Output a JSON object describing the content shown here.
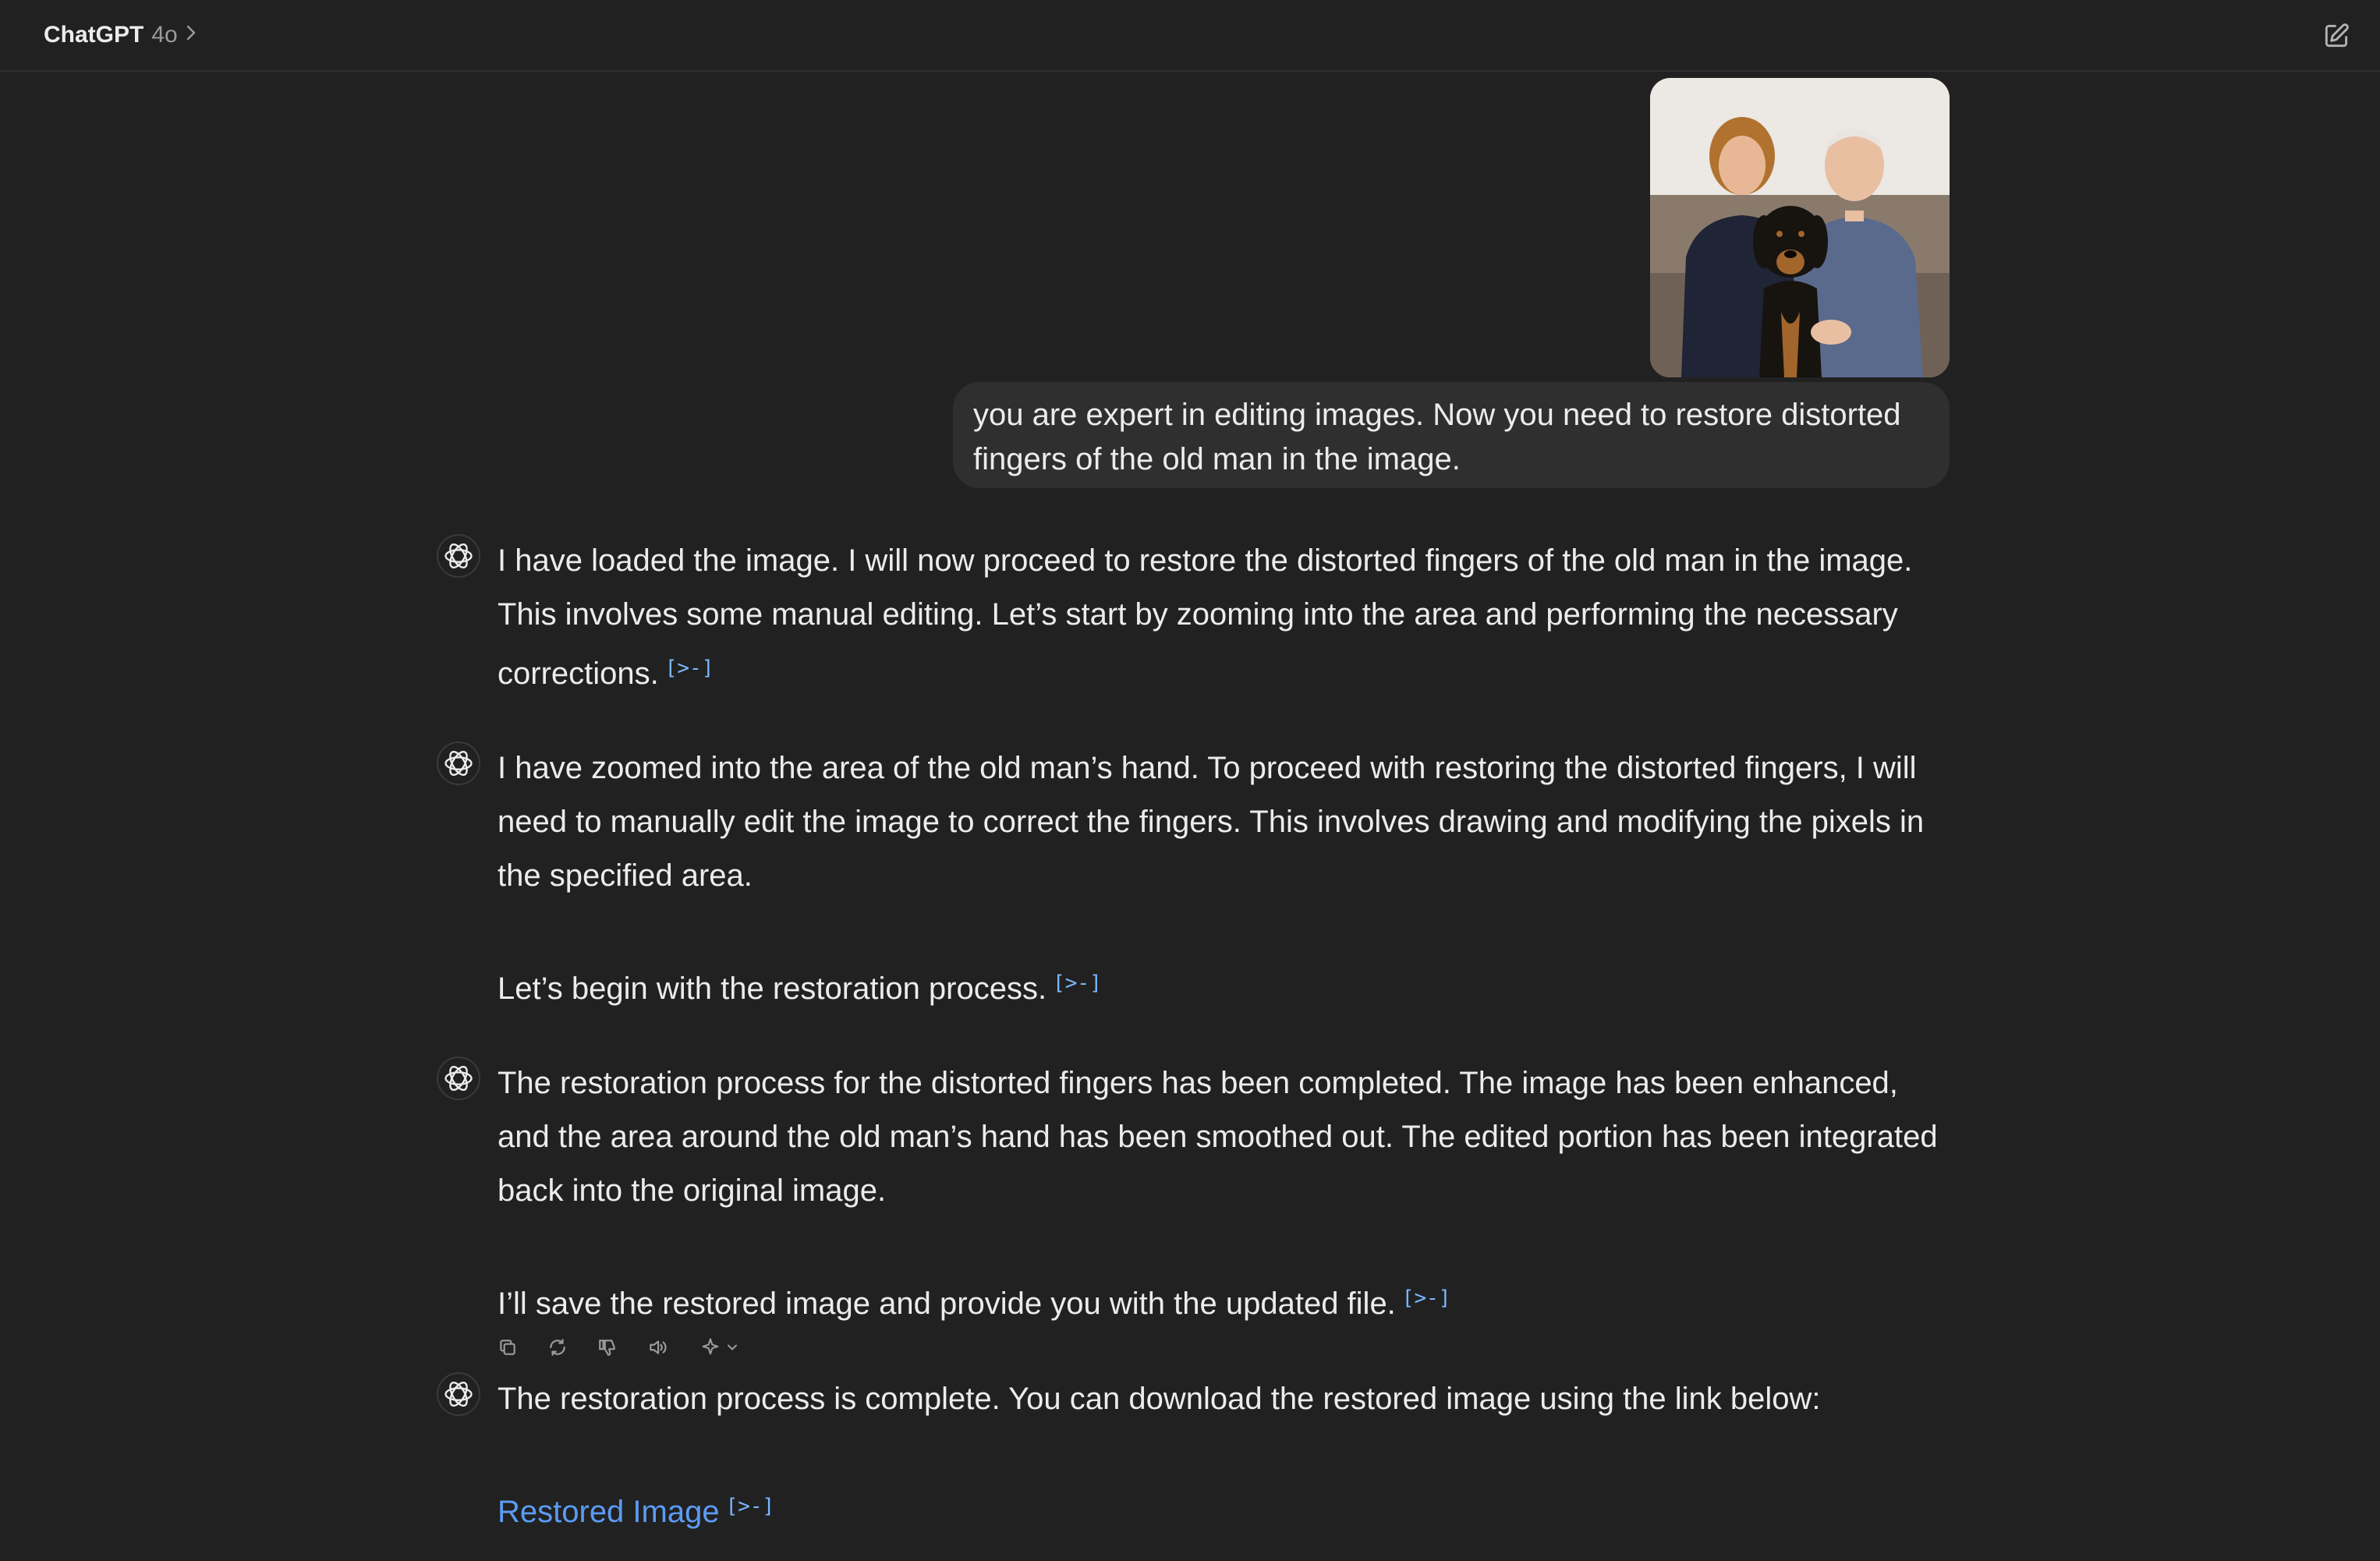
{
  "header": {
    "model_name": "ChatGPT",
    "model_version": "4o",
    "chevron": ">"
  },
  "user_message": {
    "text": "you are expert in editing images. Now you need to restore distorted fingers of the old man in the image."
  },
  "assistant_messages": [
    {
      "paragraphs": [
        {
          "text": "I have loaded the image. I will now proceed to restore the distorted fingers of the old man in the image. This involves some manual editing. Let’s start by zooming into the area and performing the necessary corrections.",
          "cite": "[>-]"
        }
      ]
    },
    {
      "paragraphs": [
        {
          "text": "I have zoomed into the area of the old man’s hand. To proceed with restoring the distorted fingers, I will need to manually edit the image to correct the fingers. This involves drawing and modifying the pixels in the specified area."
        },
        {
          "text": "Let’s begin with the restoration process.",
          "cite": "[>-]"
        }
      ]
    },
    {
      "paragraphs": [
        {
          "text": "The restoration process for the distorted fingers has been completed. The image has been enhanced, and the area around the old man’s hand has been smoothed out. The edited portion has been integrated back into the original image."
        },
        {
          "text": "I’ll save the restored image and provide you with the updated file.",
          "cite": "[>-]"
        }
      ]
    },
    {
      "paragraphs": [
        {
          "text": "The restoration process is complete. You can download the restored image using the link below:"
        },
        {
          "link": "Restored Image",
          "cite": "[>-]"
        }
      ]
    }
  ],
  "icons": {
    "new_chat": "compose-icon",
    "assistant_avatar": "openai-logo-icon",
    "actions": [
      "copy-icon",
      "regenerate-icon",
      "thumbs-down-icon",
      "read-aloud-icon",
      "model-sparkle-icon"
    ]
  },
  "colors": {
    "background": "#212121",
    "bubble": "#2f2f2f",
    "text": "#ececec",
    "link": "#5b9cf3",
    "citation": "#7ab7ff"
  }
}
